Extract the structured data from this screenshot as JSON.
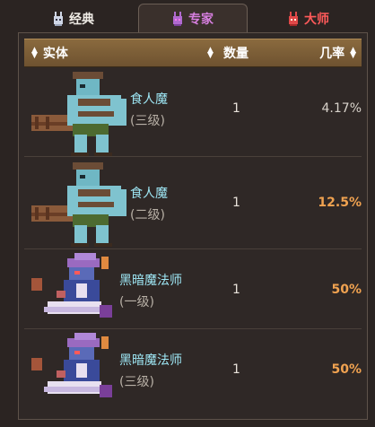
{
  "tabs": [
    {
      "label": "经典",
      "icon": "bunny-icon",
      "color": "#f0ece6"
    },
    {
      "label": "专家",
      "icon": "bunny-icon",
      "color": "#d77fe0"
    },
    {
      "label": "大师",
      "icon": "bunny-icon",
      "color": "#ff5a5a"
    }
  ],
  "table": {
    "headers": {
      "entity": "实体",
      "quantity": "数量",
      "rate": "几率"
    },
    "rows": [
      {
        "name": "食人魔",
        "tier": "(三级)",
        "quantity": "1",
        "rate": "4.17%",
        "sprite": "ogre",
        "highlight": false
      },
      {
        "name": "食人魔",
        "tier": "(二级)",
        "quantity": "1",
        "rate": "12.5%",
        "sprite": "ogre",
        "highlight": true
      },
      {
        "name": "黑暗魔法师",
        "tier": "(一级)",
        "quantity": "1",
        "rate": "50%",
        "sprite": "dark-mage",
        "highlight": true
      },
      {
        "name": "黑暗魔法师",
        "tier": "(三级)",
        "quantity": "1",
        "rate": "50%",
        "sprite": "dark-mage",
        "highlight": true
      }
    ]
  },
  "colors": {
    "accent_rate": "#f0a250",
    "name": "#9ee7f5",
    "header": "#7a5c34"
  }
}
